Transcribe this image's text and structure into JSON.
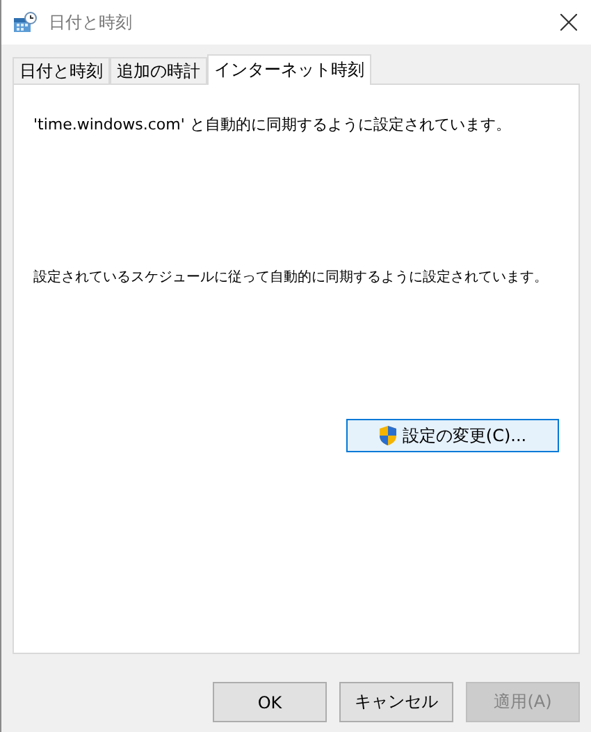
{
  "window": {
    "title": "日付と時刻"
  },
  "tabs": [
    {
      "label": "日付と時刻",
      "selected": false
    },
    {
      "label": "追加の時計",
      "selected": false
    },
    {
      "label": "インターネット時刻",
      "selected": true
    }
  ],
  "panel": {
    "status": "'time.windows.com' と自動的に同期するように設定されています。",
    "schedule": "設定されているスケジュールに従って自動的に同期するように設定されています。",
    "change_button": "設定の変更(C)..."
  },
  "buttons": [
    {
      "label": "OK",
      "disabled": false
    },
    {
      "label": "キャンセル",
      "disabled": false
    },
    {
      "label": "適用(A)",
      "disabled": true
    }
  ]
}
